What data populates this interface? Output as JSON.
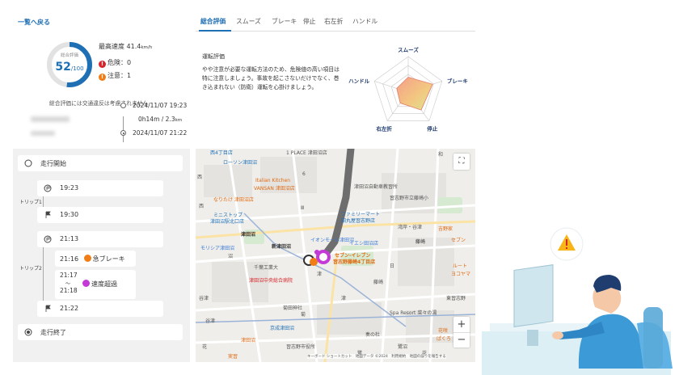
{
  "summary": {
    "back_link": "一覧へ戻る",
    "gauge": {
      "label": "総合評価",
      "score": "52",
      "max": "/100",
      "fraction": 0.52
    },
    "max_speed": {
      "label": "最高速度",
      "value": "41.4",
      "unit": "km/h"
    },
    "danger": {
      "label": "危険：0"
    },
    "caution": {
      "label": "注意：1"
    },
    "note": "総合評価には交通違反は考慮されません",
    "trip": {
      "start_time": "2024/11/07 19:23",
      "duration": "0h14m",
      "separator": " / ",
      "distance": "2.3",
      "distance_unit": "km",
      "end_time": "2024/11/07 21:22"
    }
  },
  "timeline": {
    "start": "走行開始",
    "end": "走行終了",
    "trip1": {
      "label": "トリップ1",
      "times": [
        "19:23",
        "19:30"
      ]
    },
    "trip2": {
      "label": "トリップ2",
      "start": "21:13",
      "event1": {
        "time": "21:16",
        "label": "急ブレーキ"
      },
      "event2": {
        "time_from": "21:17",
        "tilde": "〜",
        "time_to": "21:18",
        "label": "速度超過"
      },
      "end": "21:22"
    }
  },
  "evaluation": {
    "tabs": [
      "総合評価",
      "スムーズ",
      "ブレーキ",
      "停止",
      "右左折",
      "ハンドル"
    ],
    "title": "運転評価",
    "description": "やや注意が必要な運転方法のため、危険値の高い項目は特に注意しましょう。事故を起こさないだけでなく、巻き込まれない（防衛）運転を心掛けましょう。",
    "radar": {
      "axes": [
        "スムーズ",
        "ブレーキ",
        "停止",
        "右左折",
        "ハンドル"
      ],
      "values": [
        0.42,
        0.72,
        0.62,
        0.38,
        0.34
      ]
    }
  },
  "map": {
    "labels": {
      "l1": "西4丁目店",
      "l2": "ローソン津田沼",
      "l3": "Italian Kitchen",
      "l4": "VANSAN 津田沼店",
      "l5": "なりたけ 津田沼店",
      "l6": "ミニストップ",
      "l7": "津田沼駅北口店",
      "l8": "モリシア津田沼",
      "l9": "津田沼",
      "l10": "新津田沼",
      "l11": "イオンモール津田沼",
      "l12": "セブン-イレブン",
      "l13": "習志野藤崎4丁目店",
      "l14": "千葉工業大",
      "l15": "津田沼中央総合病院",
      "l16": "菊田神社",
      "l17": "京成津田沼",
      "l18": "習志野市役所",
      "l19": "ファミリーマート",
      "l20": "田丸屋習志野店",
      "l21": "習志野市立藤崎小",
      "l22": "吉野家",
      "l23": "藤崎",
      "l24": "Spa Resort 菜々の湯",
      "l25": "津田沼自動車教習所",
      "l26": "イエシ田沼店",
      "l27": "谷津",
      "l28": "東習志野",
      "l29": "鷺沼",
      "l30": "奏の杜",
      "l31": "花咲",
      "l32": "セブン",
      "l33": "ルート",
      "l34": "ヨコヤマ",
      "l35": "藤崎",
      "l36": "湾岸・谷津",
      "l37": "和",
      "l38": "ぱくろ",
      "l39": "津田沼",
      "l40": "実習",
      "l41": "花",
      "l42": "谷津",
      "l43": "1 PLACE 津田沼店",
      "l44": "西",
      "l45": "菊",
      "l46": "西",
      "l47": "Ⅲ",
      "l48": "津",
      "l49": "沼",
      "l50": "鷺",
      "l51": "花",
      "l52": "6",
      "l53": "津",
      "l54": "日"
    },
    "footer": "キーボード ショートカット　地図データ ©2024　利用規約　地図の誤りを報告する",
    "zoom_in": "+",
    "zoom_out": "−"
  },
  "colors": {
    "accent": "#1f6fb5",
    "danger": "#d7262b",
    "caution": "#f07d16",
    "route": "#6e6e6e",
    "speeding": "#c43ad6"
  }
}
